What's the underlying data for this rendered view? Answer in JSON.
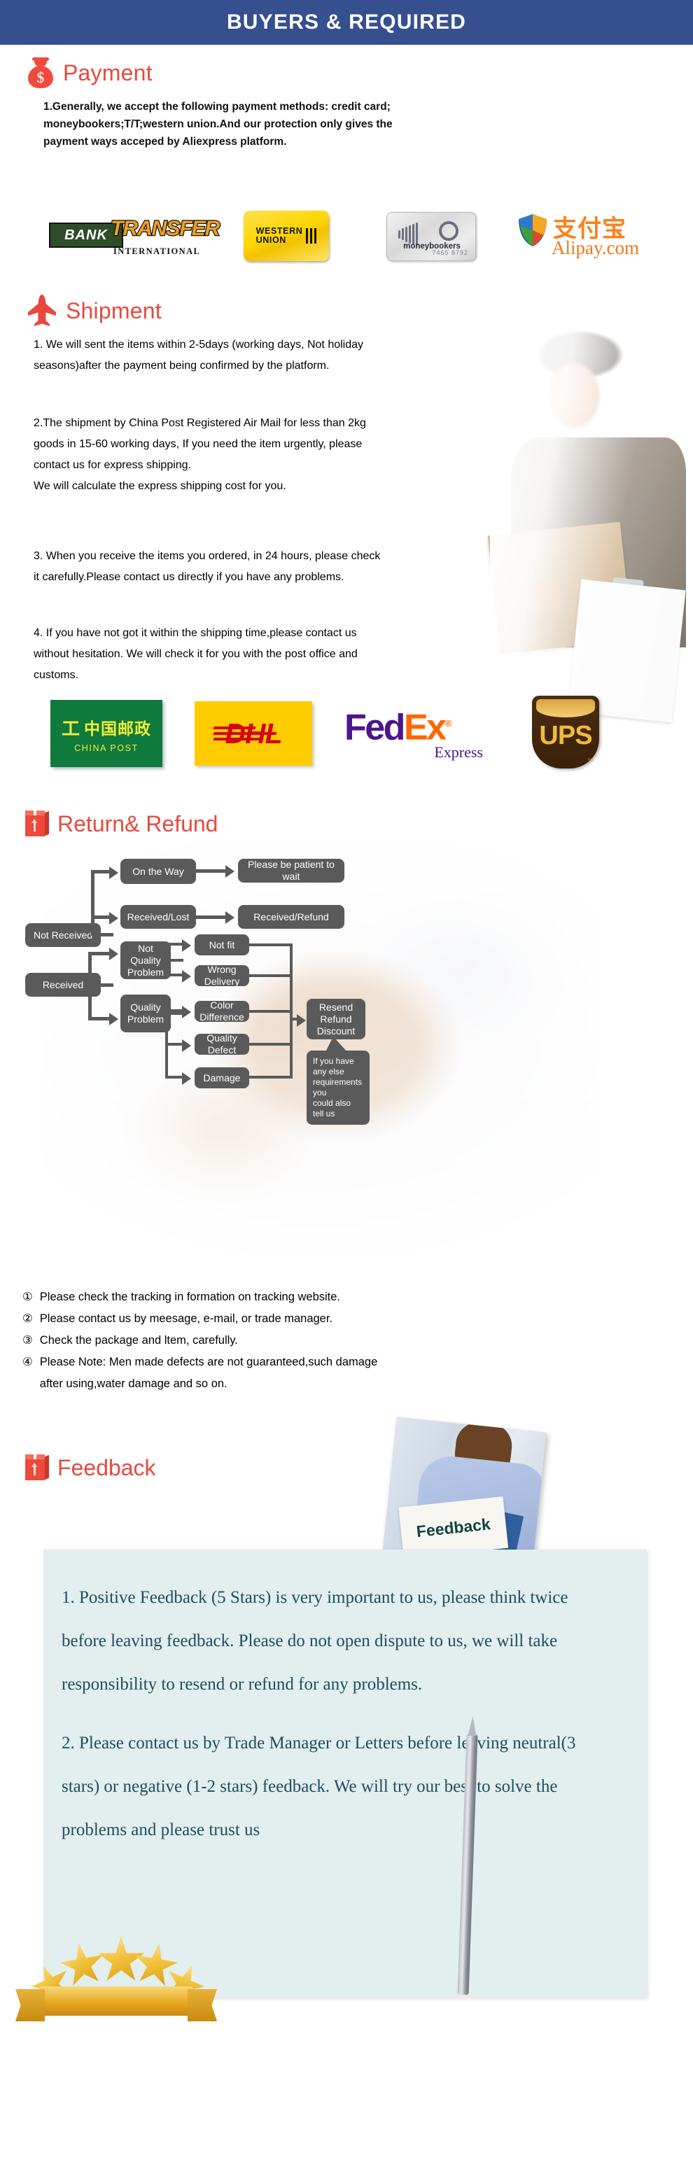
{
  "banner": {
    "title": "BUYERS & REQUIRED"
  },
  "payment": {
    "heading": "Payment",
    "icon": "money-bag-icon",
    "body": "1.Generally, we accept the following payment methods: credit card;\nmoneybookers;T/T;western union.And our protection only gives the\npayment ways acceped by Aliexpress platform.",
    "logos": [
      {
        "name": "bank-transfer-logo",
        "line1": "BANK",
        "line2": "TRANSFER",
        "line3": "INTERNATIONAL"
      },
      {
        "name": "western-union-logo",
        "line1": "WESTERN",
        "line2": "UNION"
      },
      {
        "name": "moneybookers-logo",
        "label": "moneybookers",
        "number": "7465 8792"
      },
      {
        "name": "alipay-logo",
        "cn": "支付宝",
        "en": "Alipay.com"
      }
    ]
  },
  "shipment": {
    "heading": "Shipment",
    "icon": "airplane-icon",
    "p1": "1. We will sent the items within 2-5days (working days, Not holiday\nseasons)after the payment being confirmed by the platform.",
    "p2": "2.The shipment by China Post Registered Air Mail for less than  2kg\ngoods in 15-60 working days, If  you need the item urgently, please\ncontact us for express shipping.\nWe will calculate the express shipping cost for you.",
    "p3": "3. When you receive the items you ordered, in 24 hours, please check\n it carefully.Please contact us directly if you have any problems.",
    "p4": "4. If you have not got it within the shipping time,please contact us\nwithout hesitation. We will check it for you with the post office and\ncustoms.",
    "couriers": [
      {
        "name": "china-post-logo",
        "cn": "中国邮政",
        "en": "CHINA POST"
      },
      {
        "name": "dhl-logo",
        "text": "DHL"
      },
      {
        "name": "fedex-logo",
        "fed": "Fed",
        "ex": "Ex",
        "express": "Express"
      },
      {
        "name": "ups-logo",
        "text": "UPS"
      }
    ]
  },
  "returnRefund": {
    "heading": "Return& Refund",
    "icon": "return-box-icon",
    "flow": {
      "not_received": "Not Received",
      "on_the_way": "On the Way",
      "please_wait": "Please be patient to wait",
      "received_lost": "Received/Lost",
      "received_refund": "Received/Refund",
      "received": "Received",
      "not_quality_problem": "Not\nQuality\nProblem",
      "quality_problem": "Quality\nProblem",
      "not_fit": "Not fit",
      "wrong_delivery": "Wrong Delivery",
      "color_difference": "Color Difference",
      "quality_defect": "Quality Defect",
      "damage": "Damage",
      "resend_refund_discount": "Resend\nRefund\nDiscount",
      "callout": "If you have any else\nrequirements you\ncould also tell us"
    },
    "notes": [
      {
        "num": "①",
        "text": "Please check the tracking in formation on tracking website."
      },
      {
        "num": "②",
        "text": "Please contact us by meesage, e-mail, or trade manager."
      },
      {
        "num": "③",
        "text": "Check the package and ltem, carefully."
      },
      {
        "num": "④",
        "text": "Please Note: Men made defects  are not guaranteed,such damage\n    after using,water damage and so on."
      }
    ]
  },
  "feedback": {
    "heading": "Feedback",
    "icon": "feedback-box-icon",
    "photo_card_label": "Feedback",
    "p1": "1. Positive Feedback (5 Stars) is very important to us, please think twice before leaving feedback. Please do not open dispute to us,   we will take responsibility to resend or refund for any problems.",
    "p2": "2. Please contact us by Trade Manager or Letters before leaving neutral(3 stars) or negative (1-2 stars) feedback. We will try our best to solve the problems and please trust us"
  },
  "colors": {
    "banner_bg": "#364f8e",
    "heading_red": "#e8493f",
    "flow_gray": "#5a5a5a",
    "feedback_panel": "#e3eeee",
    "feedback_text": "#1f4e5c"
  }
}
